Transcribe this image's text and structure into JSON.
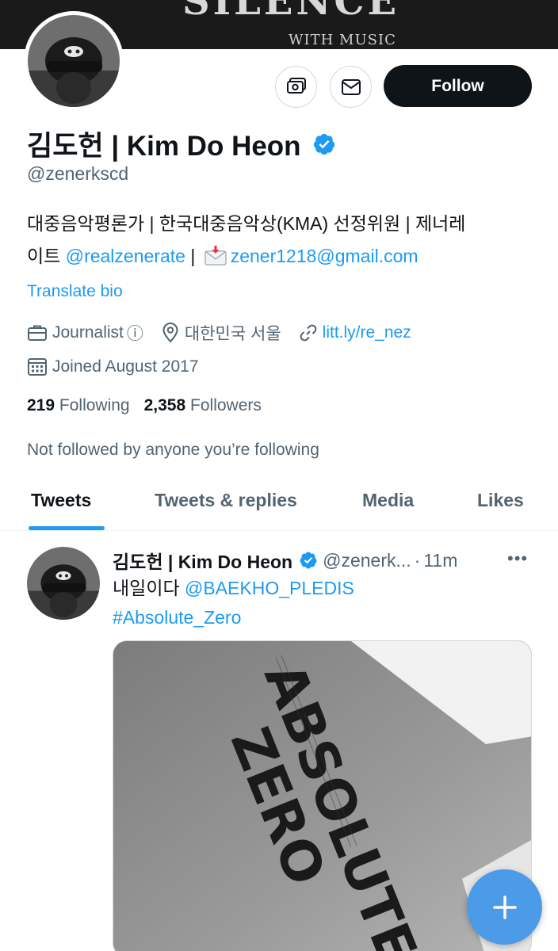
{
  "banner": {
    "big_text": "SILENCE",
    "small_text": "WITH MUSIC"
  },
  "header": {
    "follow_label": "Follow"
  },
  "profile": {
    "name": "김도헌 | Kim Do Heon",
    "handle": "@zenerkscd",
    "bio_line1": "대중음악평론가 | 한국대중음악상(KMA) 선정위원 | 제너레",
    "bio_line2_prefix": "이트 ",
    "bio_mention": "@realzenerate",
    "bio_separator": " | ",
    "bio_email": "zener1218@gmail.com",
    "translate_label": "Translate bio",
    "category": "Journalist",
    "info_symbol": "ⓘ",
    "location": "대한민국 서울",
    "website": "litt.ly/re_nez",
    "joined": "Joined August 2017",
    "following_count": "219",
    "following_label": "Following",
    "followers_count": "2,358",
    "followers_label": "Followers",
    "not_followed": "Not followed by anyone you’re following"
  },
  "tabs": [
    {
      "label": "Tweets"
    },
    {
      "label": "Tweets & replies"
    },
    {
      "label": "Media"
    },
    {
      "label": "Likes"
    }
  ],
  "tweet": {
    "name": "김도헌 | Kim Do Heon",
    "handle": "@zenerk...",
    "separator": "·",
    "time": "11m",
    "more": "•••",
    "text_prefix": "내일이다 ",
    "mention": "@BAEKHO_PLEDIS",
    "hashtag": "#Absolute_Zero",
    "media_text_main": "ABSOLUTE",
    "media_text_sub": "ZERO"
  },
  "fab": {
    "symbol": "+"
  },
  "colors": {
    "accent": "#1d9bf0",
    "text": "#0f1419",
    "secondary": "#536471",
    "fab": "#4c9be8"
  }
}
